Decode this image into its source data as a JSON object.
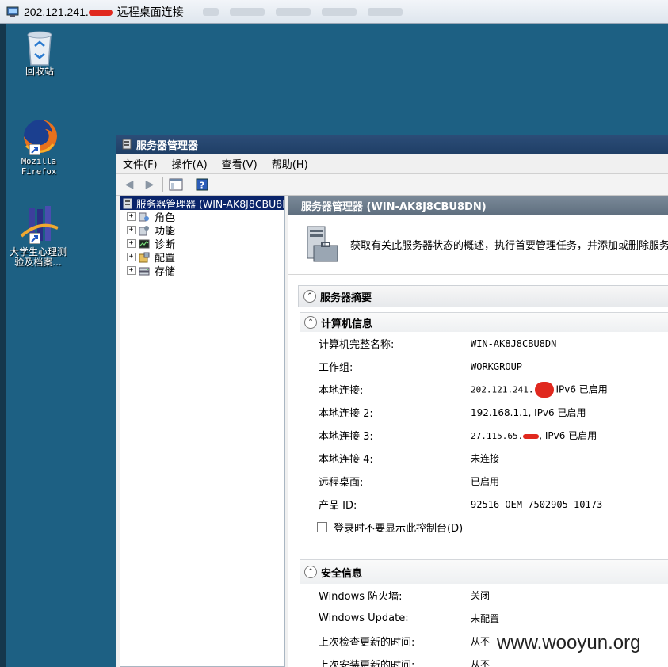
{
  "rdp": {
    "title_prefix": "202.121.241.",
    "title_suffix": "远程桌面连接"
  },
  "desktop": {
    "icons": [
      {
        "label": "回收站",
        "icon": "recycle-bin-icon"
      },
      {
        "label_line1": "Mozilla",
        "label_line2": "Firefox",
        "icon": "firefox-icon"
      },
      {
        "label_line1": "大学生心理测",
        "label_line2": "验及档案...",
        "icon": "app-shortcut-icon"
      }
    ]
  },
  "window": {
    "title": "服务器管理器",
    "menu": [
      "文件(F)",
      "操作(A)",
      "查看(V)",
      "帮助(H)"
    ]
  },
  "tree": {
    "root": "服务器管理器 (WIN-AK8J8CBU8DN)",
    "items": [
      "角色",
      "功能",
      "诊断",
      "配置",
      "存储"
    ]
  },
  "pane": {
    "header": "服务器管理器 (WIN-AK8J8CBU8DN)",
    "description": "获取有关此服务器状态的概述，执行首要管理任务，并添加或删除服务器",
    "summary_title": "服务器摘要",
    "computer_info": {
      "title": "计算机信息",
      "rows": [
        {
          "k": "计算机完整名称:",
          "v": "WIN-AK8J8CBU8DN"
        },
        {
          "k": "工作组:",
          "v": "WORKGROUP"
        },
        {
          "k": "本地连接:",
          "v1": "202.121.241.",
          "v2": "IPv6 已启用"
        },
        {
          "k": "本地连接 2:",
          "v": "192.168.1.1, IPv6 已启用"
        },
        {
          "k": "本地连接 3:",
          "v1": "27.115.65.",
          "v2": ", IPv6 已启用"
        },
        {
          "k": "本地连接 4:",
          "v": "未连接"
        },
        {
          "k": "远程桌面:",
          "v": "已启用"
        },
        {
          "k": "产品 ID:",
          "v": "92516-OEM-7502905-10173"
        }
      ],
      "checkbox": "登录时不要显示此控制台(D)"
    },
    "security_info": {
      "title": "安全信息",
      "rows": [
        {
          "k": "Windows 防火墙:",
          "v": "关闭"
        },
        {
          "k": "Windows Update:",
          "v": "未配置"
        },
        {
          "k": "上次检查更新的时间:",
          "v": "从不"
        },
        {
          "k": "上次安装更新的时间:",
          "v": "从不"
        }
      ]
    }
  },
  "watermark": "www.wooyun.org"
}
